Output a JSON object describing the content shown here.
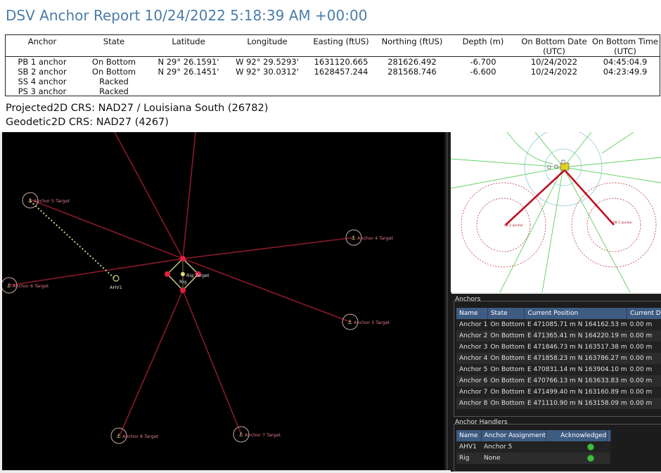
{
  "report": {
    "title": "DSV Anchor Report 10/24/2022 5:18:39 AM +00:00",
    "columns": [
      "Anchor",
      "State",
      "Latitude",
      "Longitude",
      "Easting (ftUS)",
      "Northing (ftUS)",
      "Depth (m)",
      "On Bottom Date (UTC)",
      "On Bottom Time (UTC)"
    ],
    "rows": [
      [
        "PB 1 anchor",
        "On Bottom",
        "N 29° 26.1591'",
        "W 92° 29.5293'",
        "1631120.665",
        "281626.492",
        "-6.700",
        "10/24/2022",
        "04:45:04.9"
      ],
      [
        "SB 2 anchor",
        "On Bottom",
        "N 29° 26.1451'",
        "W 92° 30.0312'",
        "1628457.244",
        "281568.746",
        "-6.600",
        "10/24/2022",
        "04:23:49.9"
      ],
      [
        "SS 4 anchor",
        "Racked",
        "",
        "",
        "",
        "",
        "",
        "",
        ""
      ],
      [
        "PS 3 anchor",
        "Racked",
        "",
        "",
        "",
        "",
        "",
        "",
        ""
      ]
    ],
    "projected_crs": "Projected2D CRS: NAD27 / Louisiana South (26782)",
    "geodetic_crs": "Geodetic2D CRS: NAD27 (4267)"
  },
  "map": {
    "rig_label": "Rig",
    "rig_target_label": "Rig Target",
    "handler_label": "AHV1",
    "targets": [
      "Anchor 5 Target",
      "Anchor 4 Target",
      "Anchor 6 Target",
      "Anchor 3 Target",
      "Anchor 8 Target",
      "Anchor 7 Target"
    ]
  },
  "mini_map": {
    "labels": [
      "SB 2 anchor",
      "PB 1 anchor"
    ]
  },
  "anchors_panel": {
    "title": "Anchors",
    "columns": [
      "Name",
      "State",
      "Current Position",
      "Current Depth"
    ],
    "rows": [
      [
        "Anchor 1",
        "On Bottom",
        "E 471085.71 m N 164162.53 m",
        "0.00 m"
      ],
      [
        "Anchor 2",
        "On Bottom",
        "E 471365.41 m N 164220.19 m",
        "0.00 m"
      ],
      [
        "Anchor 3",
        "On Bottom",
        "E 471846.73 m N 163517.38 m",
        "0.00 m"
      ],
      [
        "Anchor 4",
        "On Bottom",
        "E 471858.23 m N 163786.27 m",
        "0.00 m"
      ],
      [
        "Anchor 5",
        "On Bottom",
        "E 470831.14 m N 163904.10 m",
        "0.00 m"
      ],
      [
        "Anchor 6",
        "On Bottom",
        "E 470766.13 m N 163633.83 m",
        "0.00 m"
      ],
      [
        "Anchor 7",
        "On Bottom",
        "E 471499.40 m N 163160.89 m",
        "0.00 m"
      ],
      [
        "Anchor 8",
        "On Bottom",
        "E 471110.90 m N 163158.09 m",
        "0.00 m"
      ]
    ]
  },
  "handlers_panel": {
    "title": "Anchor Handlers",
    "columns": [
      "Name",
      "Anchor Assignment",
      "Acknowledged"
    ],
    "rows": [
      [
        "AHV1",
        "Anchor 5"
      ],
      [
        "Rig",
        "None"
      ]
    ]
  },
  "colors": {
    "accent": "#4a7da8",
    "mooring_line": "#8a1a2a",
    "target_ring": "#c9a9a0",
    "grid_header": "#3e5b82",
    "ack_ok": "#3fbf3f"
  }
}
